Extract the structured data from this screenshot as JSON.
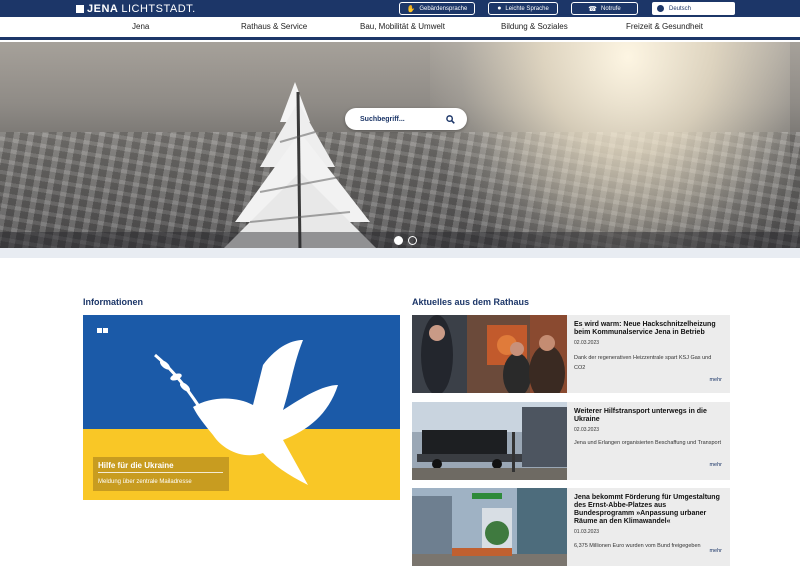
{
  "header": {
    "logo_bold": "JENA",
    "logo_light": "LICHTSTADT.",
    "buttons": [
      {
        "label": "Gebärdensprache",
        "icon": "hand-icon"
      },
      {
        "label": "Leichte Sprache",
        "icon": "person-icon"
      },
      {
        "label": "Notrufe",
        "icon": "phone-icon"
      }
    ],
    "language": {
      "selected": "Deutsch",
      "icon": "globe-icon"
    }
  },
  "nav": {
    "items": [
      "Jena",
      "Rathaus & Service",
      "Bau, Mobilität & Umwelt",
      "Bildung & Soziales",
      "Freizeit & Gesundheit"
    ]
  },
  "hero": {
    "search_placeholder": "Suchbegriff...",
    "slides": 2,
    "active_slide": 1
  },
  "informationen": {
    "heading": "Informationen",
    "teaser_title": "Hilfe für die Ukraine",
    "teaser_subtitle": "Meldung über zentrale Mailadresse"
  },
  "aktuelles": {
    "heading": "Aktuelles aus dem Rathaus",
    "items": [
      {
        "title": "Es wird warm: Neue Hackschnitzelheizung beim Kommunalservice Jena in Betrieb",
        "date": "02.03.2023",
        "text": "Dank der regenerativen Heizzentrale spart KSJ Gas und CO2",
        "more": "mehr"
      },
      {
        "title": "Weiterer Hilfstransport unterwegs in die Ukraine",
        "date": "02.03.2023",
        "text": "Jena und Erlangen organisierten Beschaffung und Transport",
        "more": "mehr"
      },
      {
        "title": "Jena bekommt Förderung für Umgestaltung des Ernst-Abbe-Platzes aus Bundesprogramm »Anpassung urbaner Räume an den Klimawandel«",
        "date": "01.03.2023",
        "text": "6,375 Millionen Euro wurden vom Bund freigegeben",
        "more": "mehr"
      }
    ]
  },
  "colors": {
    "brand_blue": "#1c3668",
    "ukraine_blue": "#1b5aa8",
    "ukraine_yellow": "#f9c726"
  }
}
